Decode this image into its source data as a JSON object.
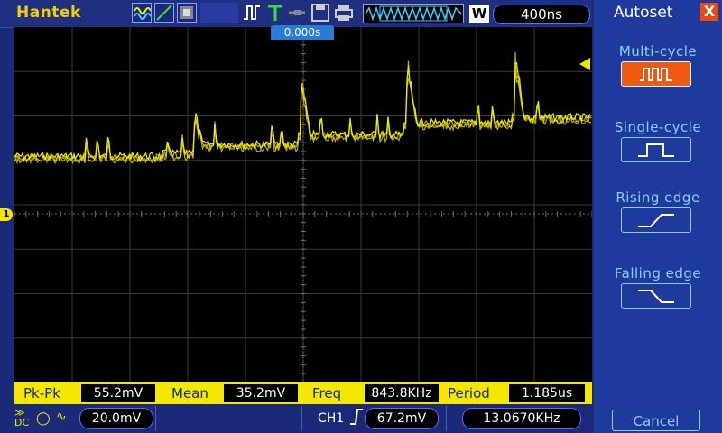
{
  "brand": "Hantek",
  "toolbar": {
    "icons": [
      "waveform-mode-icon",
      "math-icon",
      "display-icon",
      "trigger-pulse-icon",
      "trigger-T-icon",
      "probe-icon",
      "save-icon",
      "print-icon",
      "memory-waveform-icon"
    ],
    "w_label": "W",
    "timebase": "400ns"
  },
  "trigger_time": "0.000s",
  "channel_marker": "1",
  "measurements": [
    {
      "label": "Pk-Pk",
      "value": "55.2mV"
    },
    {
      "label": "Mean",
      "value": "35.2mV"
    },
    {
      "label": "Freq",
      "value": "843.8KHz"
    },
    {
      "label": "Period",
      "value": "1.185us"
    }
  ],
  "status": {
    "coupling": "DC",
    "volts_div": "20.0mV",
    "trigger_channel": "CH1",
    "trigger_level": "67.2mV",
    "trigger_freq": "13.0670KHz"
  },
  "side_panel": {
    "title": "Autoset",
    "close_label": "X",
    "options": [
      {
        "label": "Multi-cycle",
        "active": true
      },
      {
        "label": "Single-cycle",
        "active": false
      },
      {
        "label": "Rising edge",
        "active": false
      },
      {
        "label": "Falling edge",
        "active": false
      }
    ],
    "cancel_label": "Cancel"
  },
  "colors": {
    "trace": "#f4e800",
    "accent": "#f05a10",
    "panel": "#1e3a9c"
  }
}
